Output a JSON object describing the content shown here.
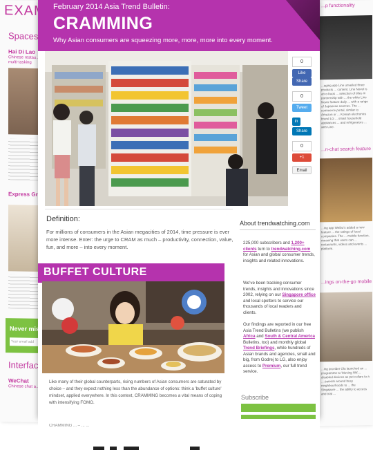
{
  "left_page": {
    "heading": "EXAMP",
    "section1": "Spaces",
    "item1_title": "Hai Di Lao",
    "item1_sub": "Chinese restau...",
    "item1_sub2": "multi-tasking",
    "item2_title": "Express Gro...",
    "newsletter": "Never miss",
    "email_placeholder": "Your email add",
    "section2": "Interface",
    "item3_title": "WeChat",
    "item3_sub": "Chinese chat a..."
  },
  "right_page": {
    "heading1": "...p functionality",
    "heading2": "...n-chat search feature",
    "heading3": "...ings on-the-go mobile",
    "text1": "...aging app Line unveiled three products ... content. Line Novel is an e-book ... selection of titles in partnership with ... the white Line News feature daily ... with a range of Japanese sources. The ... commerce portal, similar to Amazon or ... Korean electronics brand LG ... smart household appliances ... and refrigerators ... with Line.",
    "text2": "...ing app Weibo's added a new feature ... the ratings of local companies. The ... mobile function, meaning that users can ... restaurants, videos and events ... platform.",
    "text3": "...ing provider Ola launched an ... programme to 'Moving Wit'... disabled devices as pet collars to a ... parents around busy neighbourhoods to ... the Singapore ... the ability to access and trial ..."
  },
  "main": {
    "kicker": "February 2014 Asia Trend Bulletin:",
    "title": "CRAMMING",
    "tagline": "Why Asian consumers are squeezing more, more, more into every moment.",
    "share": {
      "like_count": "0",
      "like_label": "Like",
      "share_label": "Share",
      "tweet_count": "0",
      "tweet_label": "Tweet",
      "in_label": "in",
      "in_share_label": "Share",
      "plus_count": "0",
      "plus_label": "+1",
      "email_label": "Email"
    },
    "definition_heading": "Definition:",
    "definition_text": "For millions of consumers in the Asian megacities of 2014, time pressure is ever more intense. Enter: the urge to CRAM as much – productivity, connection, value, fun, and more – into every moment.",
    "buffet_title": "BUFFET CULTURE",
    "buffet_text": "Like many of their global counterparts, rising numbers of Asian consumers are saturated by choice – and they expect nothing less than the abundance of options: think a 'buffet culture' mindset, applied everywhere. In this context, CRAMMING becomes a vital means of coping with intensifying FOMO.",
    "about_heading": "About trendwatching.com",
    "about_p1_a": "225,000 subscribers and ",
    "about_p1_link": "1,200+ clients",
    "about_p1_b": " turn to ",
    "about_p1_link2": "trendwatching.com",
    "about_p1_c": " for Asian and global consumer trends, insights and related innovations.",
    "about_p2_a": "We've been tracking consumer trends, insights and innovations since 2002, relying on our ",
    "about_p2_link": "Singapore office",
    "about_p2_b": " and local spotters to service our thousands of local readers and clients.",
    "about_p3_a": "Our findings are reported in our free Asia Trend Bulletins (we publish ",
    "about_p3_link1": "Africa",
    "about_p3_b": " and ",
    "about_p3_link2": "South & Central America",
    "about_p3_c": " Bulletins, too) and monthly global ",
    "about_p3_link3": "Trend Briefings",
    "about_p3_d": ", while hundreds of Asian brands and agencies, small and big, from Godrej to LG, also enjoy access to ",
    "about_p3_link4": "Premium",
    "about_p3_e": ", our full trend service.",
    "subscribe_label": "Subscribe"
  },
  "bottom_text": "CRAMMING ... – ... ..."
}
